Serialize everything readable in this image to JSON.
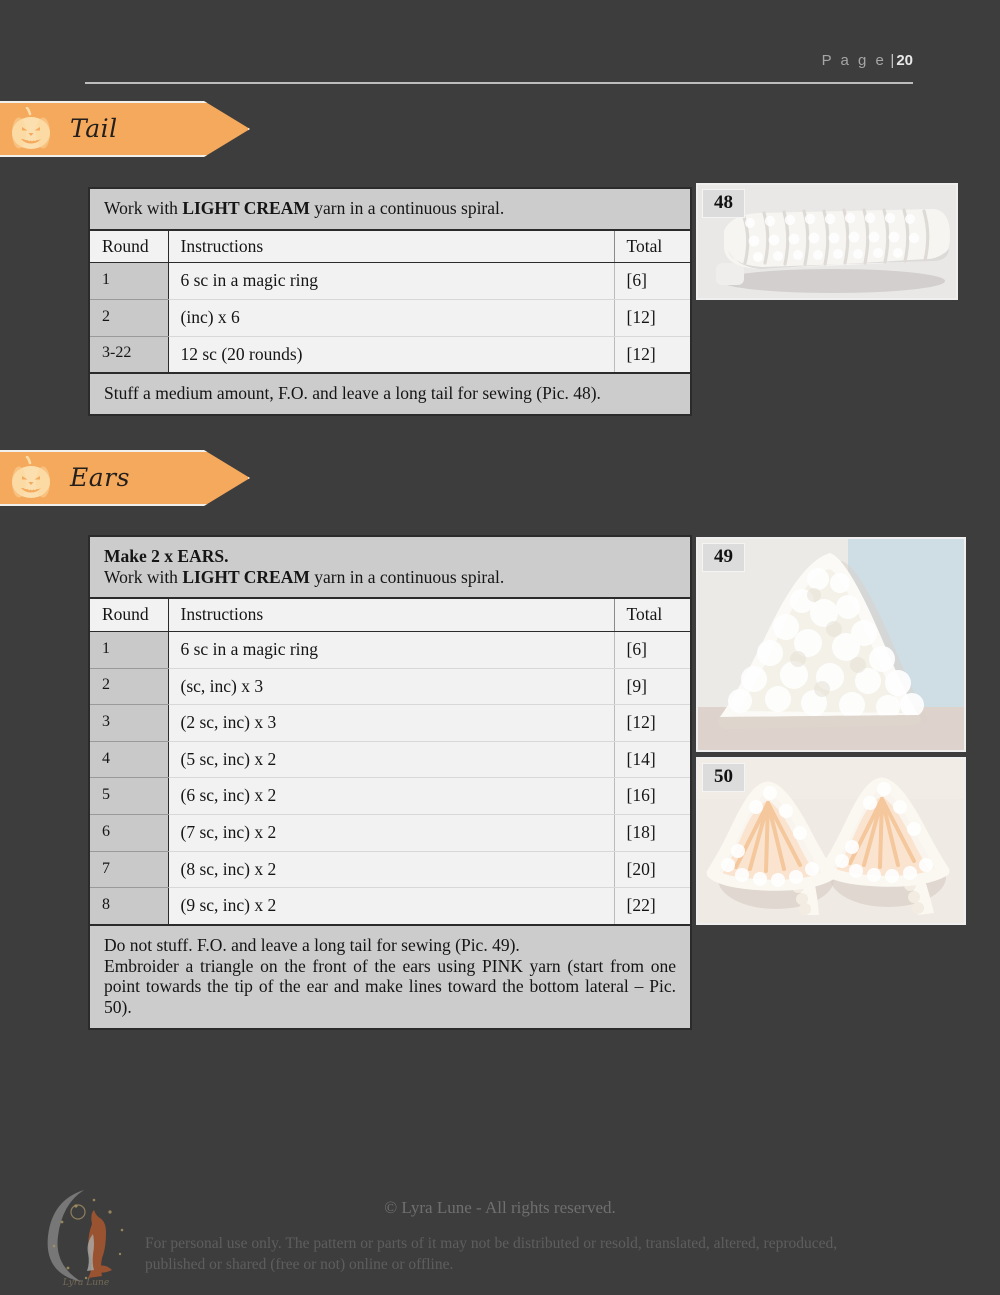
{
  "page_header": {
    "label": "P a g e",
    "separator": "|",
    "number": "20"
  },
  "colors": {
    "background": "#3d3d3d",
    "accent_orange": "#f4a95c",
    "banner_outline": "#f2f0ec",
    "table_header_gray": "#cccccc"
  },
  "sections": [
    {
      "id": "tail",
      "banner": {
        "title": "Tail",
        "icon": "pumpkin-icon"
      },
      "table": {
        "intro_prefix": "Work with ",
        "intro_strong": "LIGHT CREAM",
        "intro_suffix": " yarn in a continuous spiral.",
        "headers": {
          "round": "Round",
          "instructions": "Instructions",
          "total": "Total"
        },
        "rows": [
          {
            "round": "1",
            "instructions": "6 sc in a magic ring",
            "total": "[6]"
          },
          {
            "round": "2",
            "instructions": "(inc) x 6",
            "total": "[12]"
          },
          {
            "round": "3-22",
            "instructions": "12 sc (20 rounds)",
            "total": "[12]"
          }
        ],
        "note_lines": [
          "Stuff a medium amount, F.O. and leave a long tail for sewing (Pic. 48)."
        ]
      },
      "photos": [
        {
          "badge": "48",
          "alt": "light cream crochet tail tube"
        }
      ]
    },
    {
      "id": "ears",
      "banner": {
        "title": "Ears",
        "icon": "pumpkin-icon"
      },
      "table": {
        "make_line": "Make 2 x EARS.",
        "intro_prefix": "Work with ",
        "intro_strong": "LIGHT CREAM",
        "intro_suffix": " yarn in a continuous spiral.",
        "headers": {
          "round": "Round",
          "instructions": "Instructions",
          "total": "Total"
        },
        "rows": [
          {
            "round": "1",
            "instructions": "6 sc in a magic ring",
            "total": "[6]"
          },
          {
            "round": "2",
            "instructions": "(sc, inc) x 3",
            "total": "[9]"
          },
          {
            "round": "3",
            "instructions": "(2 sc, inc) x 3",
            "total": "[12]"
          },
          {
            "round": "4",
            "instructions": "(5 sc, inc) x 2",
            "total": "[14]"
          },
          {
            "round": "5",
            "instructions": "(6 sc, inc) x 2",
            "total": "[16]"
          },
          {
            "round": "6",
            "instructions": "(7 sc, inc) x 2",
            "total": "[18]"
          },
          {
            "round": "7",
            "instructions": "(8 sc, inc) x 2",
            "total": "[20]"
          },
          {
            "round": "8",
            "instructions": "(9 sc, inc) x 2",
            "total": "[22]"
          }
        ],
        "note_lines": [
          "Do not stuff. F.O. and leave a long tail for sewing (Pic. 49).",
          "Embroider a triangle on the front of the ears using PINK yarn (start from one point towards the tip of the ear and make lines toward the bottom lateral – Pic. 50)."
        ]
      },
      "photos": [
        {
          "badge": "49",
          "alt": "single triangular cream crochet ear"
        },
        {
          "badge": "50",
          "alt": "pair of cream ears with pink embroidered triangles"
        }
      ]
    }
  ],
  "footer": {
    "copyright": "© Lyra Lune - All rights reserved.",
    "terms": "For personal use only. The pattern or parts of it may not be distributed or resold, translated, altered, reproduced, published or shared (free or not) online or offline.",
    "logo": {
      "name": "crescent-moon-fox-logo",
      "wordmark": "Lyra Lune"
    }
  }
}
